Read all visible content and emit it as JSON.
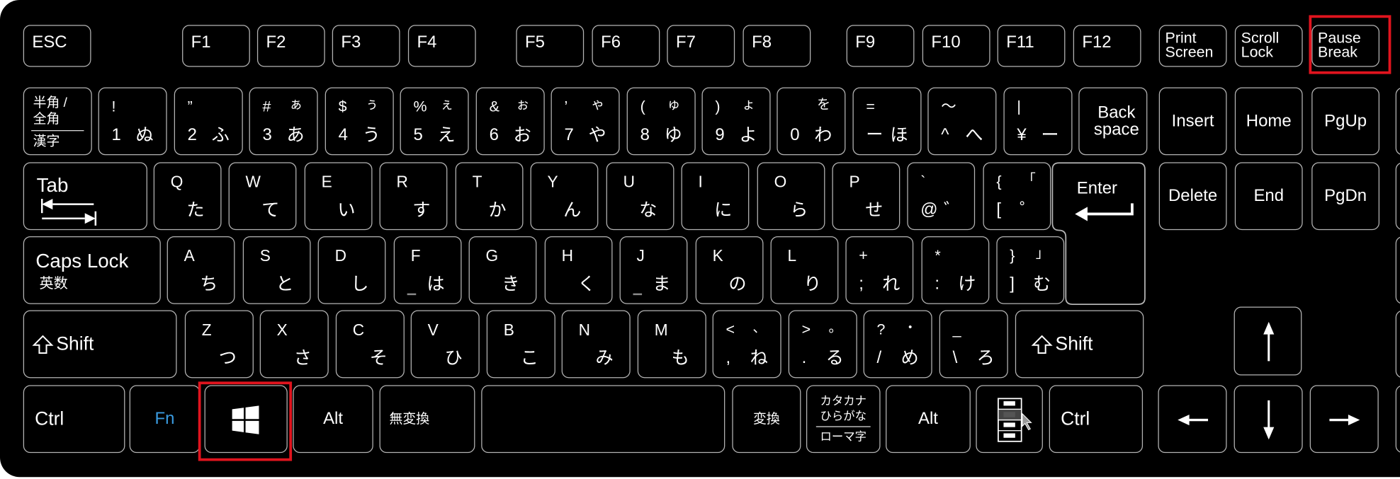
{
  "keyboard": {
    "highlight_color": "#e0141e",
    "fn_color": "#3a9be0",
    "highlighted_keys": [
      "pause-break",
      "windows"
    ],
    "rows": [
      {
        "name": "function-row",
        "keys": [
          {
            "id": "esc",
            "tl": "ESC"
          },
          {
            "id": "f1",
            "tl": "F1"
          },
          {
            "id": "f2",
            "tl": "F2"
          },
          {
            "id": "f3",
            "tl": "F3"
          },
          {
            "id": "f4",
            "tl": "F4"
          },
          {
            "id": "f5",
            "tl": "F5"
          },
          {
            "id": "f6",
            "tl": "F6"
          },
          {
            "id": "f7",
            "tl": "F7"
          },
          {
            "id": "f8",
            "tl": "F8"
          },
          {
            "id": "f9",
            "tl": "F9"
          },
          {
            "id": "f10",
            "tl": "F10"
          },
          {
            "id": "f11",
            "tl": "F11"
          },
          {
            "id": "f12",
            "tl": "F12"
          },
          {
            "id": "print-screen",
            "ml": "Print\nScreen"
          },
          {
            "id": "scroll-lock",
            "ml": "Scroll\nLock"
          },
          {
            "id": "pause-break",
            "ml": "Pause\nBreak"
          }
        ]
      },
      {
        "name": "number-row",
        "keys": [
          {
            "id": "hankaku-zenkaku",
            "l1": "半角 /",
            "l2": "全角",
            "l3": "漢字"
          },
          {
            "id": "1",
            "tl": "!",
            "bl": "1",
            "br": "ぬ"
          },
          {
            "id": "2",
            "tl": "”",
            "bl": "2",
            "br": "ふ"
          },
          {
            "id": "3",
            "tl": "#",
            "tr": "ぁ",
            "bl": "3",
            "br": "あ"
          },
          {
            "id": "4",
            "tl": "$",
            "tr": "ぅ",
            "bl": "4",
            "br": "う"
          },
          {
            "id": "5",
            "tl": "%",
            "tr": "ぇ",
            "bl": "5",
            "br": "え"
          },
          {
            "id": "6",
            "tl": "&",
            "tr": "ぉ",
            "bl": "6",
            "br": "お"
          },
          {
            "id": "7",
            "tl": "’",
            "tr": "ゃ",
            "bl": "7",
            "br": "や"
          },
          {
            "id": "8",
            "tl": "(",
            "tr": "ゅ",
            "bl": "8",
            "br": "ゆ"
          },
          {
            "id": "9",
            "tl": ")",
            "tr": "ょ",
            "bl": "9",
            "br": "よ"
          },
          {
            "id": "0",
            "tr": "を",
            "bl": "0",
            "br": "わ"
          },
          {
            "id": "minus",
            "tl": "=",
            "bl": "ー",
            "br": "ほ"
          },
          {
            "id": "caret",
            "tl": "～",
            "bl": "^",
            "br": "へ"
          },
          {
            "id": "yen",
            "tl": "|",
            "bl": "¥",
            "br": "ー"
          },
          {
            "id": "backspace",
            "cl": "Back\nspace"
          },
          {
            "id": "insert",
            "c": "Insert"
          },
          {
            "id": "home",
            "c": "Home"
          },
          {
            "id": "pgup",
            "c": "PgUp"
          }
        ]
      },
      {
        "name": "qwerty-row",
        "keys": [
          {
            "id": "tab",
            "c": "Tab"
          },
          {
            "id": "q",
            "tl": "Q",
            "br": "た"
          },
          {
            "id": "w",
            "tl": "W",
            "br": "て"
          },
          {
            "id": "e",
            "tl": "E",
            "br": "い"
          },
          {
            "id": "r",
            "tl": "R",
            "br": "す"
          },
          {
            "id": "t",
            "tl": "T",
            "br": "か"
          },
          {
            "id": "y",
            "tl": "Y",
            "br": "ん"
          },
          {
            "id": "u",
            "tl": "U",
            "br": "な"
          },
          {
            "id": "i",
            "tl": "I",
            "br": "に"
          },
          {
            "id": "o",
            "tl": "O",
            "br": "ら"
          },
          {
            "id": "p",
            "tl": "P",
            "br": "せ"
          },
          {
            "id": "at",
            "tl": "`",
            "bl": "@",
            "br": "゛"
          },
          {
            "id": "bracket-open",
            "tl": "{",
            "tr": "「",
            "bl": "[",
            "br": "゜"
          },
          {
            "id": "enter",
            "c": "Enter"
          },
          {
            "id": "delete",
            "c": "Delete"
          },
          {
            "id": "end",
            "c": "End"
          },
          {
            "id": "pgdn",
            "c": "PgDn"
          }
        ]
      },
      {
        "name": "home-row",
        "keys": [
          {
            "id": "caps-lock",
            "c": "Caps Lock",
            "s": "英数"
          },
          {
            "id": "a",
            "tl": "A",
            "br": "ち"
          },
          {
            "id": "s",
            "tl": "S",
            "br": "と"
          },
          {
            "id": "d",
            "tl": "D",
            "br": "し"
          },
          {
            "id": "f",
            "tl": "F",
            "br": "は"
          },
          {
            "id": "g",
            "tl": "G",
            "br": "き"
          },
          {
            "id": "h",
            "tl": "H",
            "br": "く"
          },
          {
            "id": "j",
            "tl": "J",
            "br": "ま"
          },
          {
            "id": "k",
            "tl": "K",
            "br": "の"
          },
          {
            "id": "l",
            "tl": "L",
            "br": "り"
          },
          {
            "id": "semicolon",
            "tl": "+",
            "bl": ";",
            "br": "れ"
          },
          {
            "id": "colon",
            "tl": "*",
            "bl": ":",
            "br": "け"
          },
          {
            "id": "bracket-close",
            "tl": "}",
            "tr": "」",
            "bl": "]",
            "br": "む"
          }
        ]
      },
      {
        "name": "shift-row",
        "keys": [
          {
            "id": "left-shift",
            "c": "Shift"
          },
          {
            "id": "z",
            "tl": "Z",
            "br": "つ"
          },
          {
            "id": "x",
            "tl": "X",
            "br": "さ"
          },
          {
            "id": "c",
            "tl": "C",
            "br": "そ"
          },
          {
            "id": "v",
            "tl": "V",
            "br": "ひ"
          },
          {
            "id": "b",
            "tl": "B",
            "br": "こ"
          },
          {
            "id": "n",
            "tl": "N",
            "br": "み"
          },
          {
            "id": "m",
            "tl": "M",
            "br": "も"
          },
          {
            "id": "comma",
            "tl": "<",
            "tr": "、",
            "bl": ",",
            "br": "ね"
          },
          {
            "id": "period",
            "tl": ">",
            "tr": "。",
            "bl": ".",
            "br": "る"
          },
          {
            "id": "slash",
            "tl": "?",
            "tr": "・",
            "bl": "/",
            "br": "め"
          },
          {
            "id": "backslash",
            "tl": "_",
            "bl": "\\",
            "br": "ろ"
          },
          {
            "id": "right-shift",
            "c": "Shift"
          },
          {
            "id": "arrow-up",
            "icon": "arrow-up"
          }
        ]
      },
      {
        "name": "bottom-row",
        "keys": [
          {
            "id": "left-ctrl",
            "c": "Ctrl"
          },
          {
            "id": "fn",
            "c": "Fn"
          },
          {
            "id": "windows",
            "icon": "windows-logo"
          },
          {
            "id": "left-alt",
            "c": "Alt"
          },
          {
            "id": "muhenkan",
            "c": "無変換"
          },
          {
            "id": "space"
          },
          {
            "id": "henkan",
            "c": "変換"
          },
          {
            "id": "katakana-hiragana",
            "l1": "カタカナ",
            "l2": "ひらがな",
            "l3": "ローマ字"
          },
          {
            "id": "right-alt",
            "c": "Alt"
          },
          {
            "id": "menu",
            "icon": "context-menu"
          },
          {
            "id": "right-ctrl",
            "c": "Ctrl"
          },
          {
            "id": "arrow-left",
            "icon": "arrow-left"
          },
          {
            "id": "arrow-down",
            "icon": "arrow-down"
          },
          {
            "id": "arrow-right",
            "icon": "arrow-right"
          }
        ]
      }
    ]
  }
}
